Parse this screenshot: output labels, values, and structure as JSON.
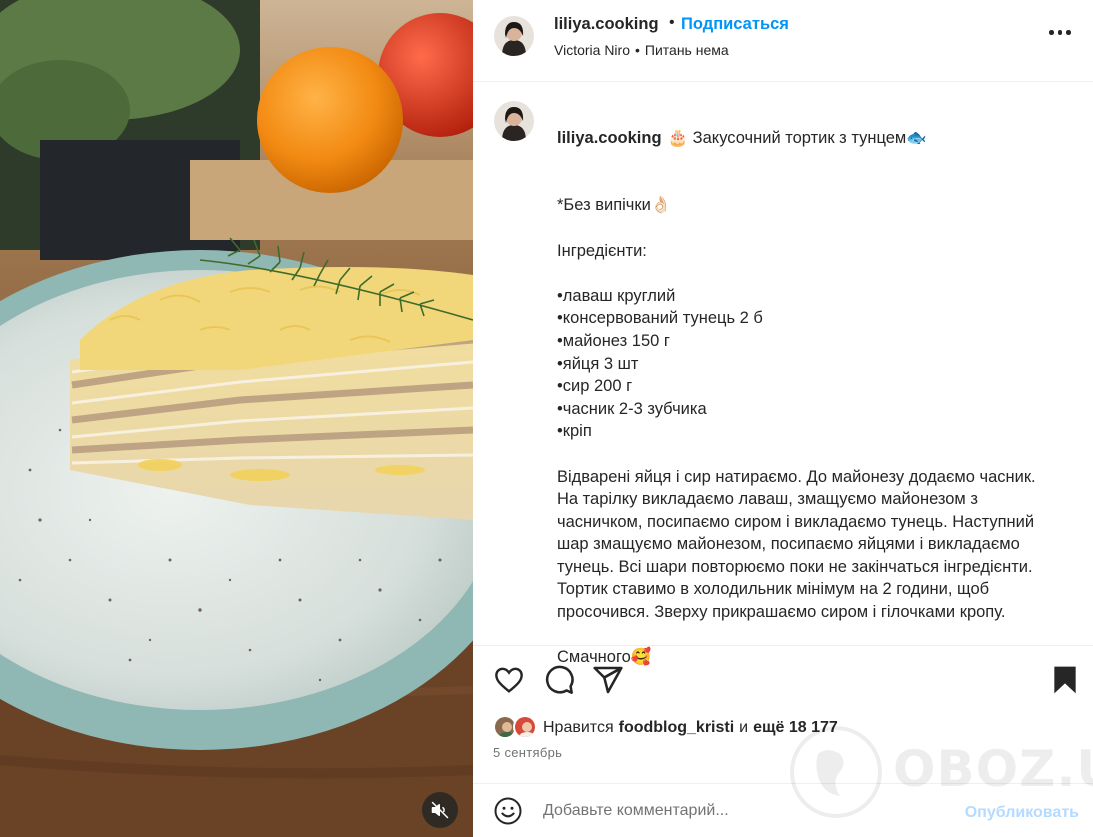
{
  "post": {
    "username": "liliya.cooking",
    "follow_label": "Подписаться",
    "header_dot": "•",
    "collaborator": "Victoria Niro",
    "audio": "Питань нема",
    "more_icon": "more-horizontal-icon"
  },
  "caption": {
    "username": "liliya.cooking",
    "lines": [
      "🎂 Закусочний тортик з тунцем🐟",
      "",
      "*Без випічки👌🏻",
      "",
      "Інгредієнти:",
      "",
      "•лаваш круглий",
      "•консервований тунець 2 б",
      "•майонез 150 г",
      "•яйця 3 шт",
      "•сир 200 г",
      "•часник 2-3 зубчика",
      "•кріп",
      "",
      "Відварені яйця і сир натираємо. До майонезу додаємо часник.",
      "На тарілку викладаємо лаваш, змащуємо майонезом з",
      "часничком, посипаємо сиром і викладаємо тунець. Наступний",
      "шар змащуємо майонезом, посипаємо яйцями і викладаємо",
      "тунець. Всі шари повторюємо поки не закінчаться інгредієнти.",
      "Тортик ставимо в холодильник мінімум на 2 години, щоб",
      "просочився. Зверху прикрашаємо сиром і гілочками кропу.",
      "",
      "Смачного🥰"
    ]
  },
  "actions": {
    "icons": [
      "heart-icon",
      "comment-icon",
      "share-icon",
      "bookmark-icon"
    ]
  },
  "likes": {
    "prefix": "Нравится",
    "user": "foodblog_kristi",
    "and": "и",
    "others": "ещё 18 177"
  },
  "date": "5 сентябрь",
  "comment": {
    "placeholder": "Добавьте комментарий...",
    "post_label": "Опубликовать",
    "emoji_icon": "smiley-icon"
  },
  "media": {
    "mute_icon": "speaker-muted-icon"
  },
  "watermark": {
    "text": "OBOZ.UA"
  },
  "colors": {
    "accent": "#0095f6",
    "post_disabled": "#b3dbff",
    "text": "#262626",
    "secondary": "#737373"
  }
}
